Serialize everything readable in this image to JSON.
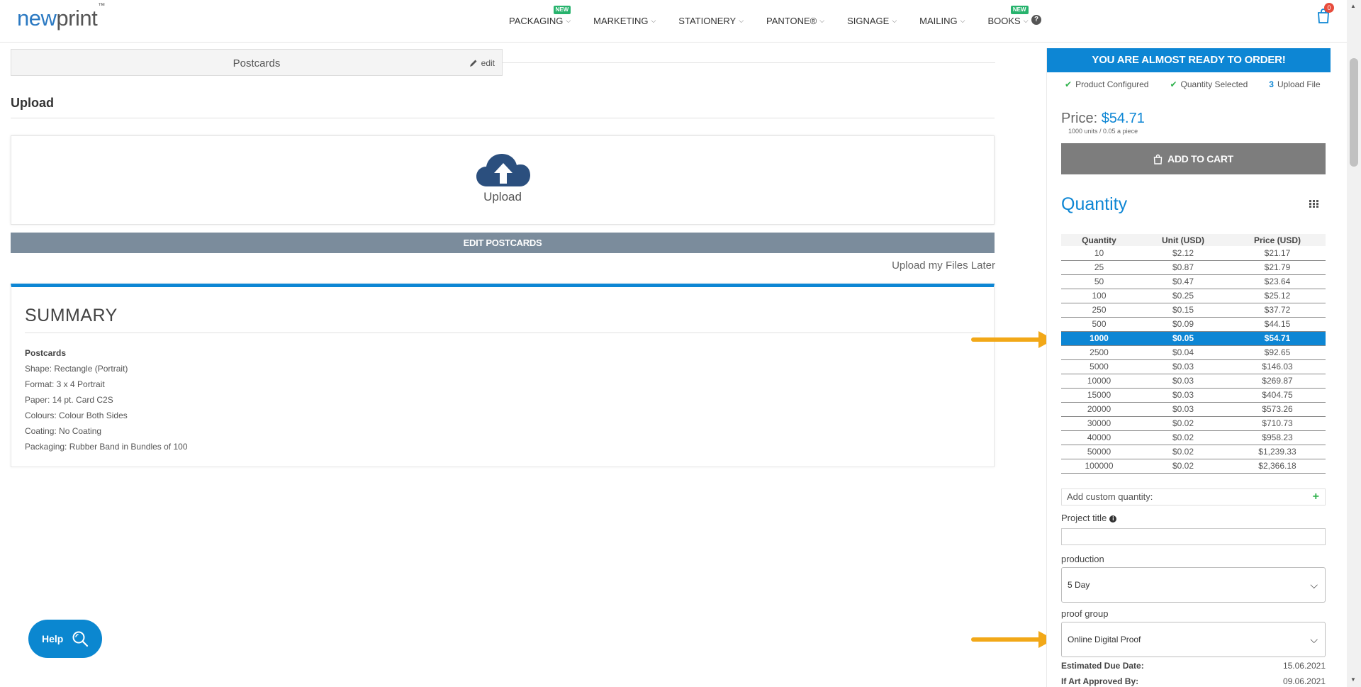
{
  "header": {
    "logo_new": "new",
    "logo_print": "print",
    "logo_tm": "™",
    "nav": [
      {
        "label": "PACKAGING",
        "badge": "NEW"
      },
      {
        "label": "MARKETING",
        "badge": ""
      },
      {
        "label": "STATIONERY",
        "badge": ""
      },
      {
        "label": "PANTONE®",
        "badge": ""
      },
      {
        "label": "SIGNAGE",
        "badge": ""
      },
      {
        "label": "MAILING",
        "badge": ""
      },
      {
        "label": "BOOKS",
        "badge": "NEW"
      }
    ],
    "help_icon": "question-circle-icon",
    "cart_icon": "shopping-bag-icon",
    "cart_count": "0"
  },
  "product_bar": {
    "name": "Postcards",
    "edit_label": "edit",
    "edit_icon": "pencil-icon"
  },
  "upload": {
    "heading": "Upload",
    "icon": "cloud-upload-icon",
    "icon_color": "#2b4f7e",
    "label": "Upload",
    "edit_button": "EDIT POSTCARDS",
    "later_link": "Upload my Files Later"
  },
  "summary": {
    "title": "SUMMARY",
    "product": "Postcards",
    "lines": [
      "Shape: Rectangle (Portrait)",
      "Format: 3 x 4 Portrait",
      "Paper: 14 pt. Card C2S",
      "Colours: Colour Both Sides",
      "Coating: No Coating",
      "Packaging: Rubber Band in Bundles of 100"
    ],
    "accent_color": "#0d86d4"
  },
  "help_widget": {
    "label": "Help",
    "icon": "search-icon"
  },
  "sidebar": {
    "ready_banner": "YOU ARE ALMOST READY TO ORDER!",
    "steps": [
      {
        "marker": "✔",
        "label": "Product Configured"
      },
      {
        "marker": "✔",
        "label": "Quantity Selected"
      },
      {
        "marker": "3",
        "label": "Upload File"
      }
    ],
    "price_label": "Price:",
    "price_value": "$54.71",
    "price_sub": "1000 units / 0.05 a piece",
    "add_to_cart": "ADD TO CART",
    "quantity_heading": "Quantity",
    "table": {
      "headers": [
        "Quantity",
        "Unit (USD)",
        "Price (USD)"
      ],
      "rows": [
        [
          "10",
          "$2.12",
          "$21.17"
        ],
        [
          "25",
          "$0.87",
          "$21.79"
        ],
        [
          "50",
          "$0.47",
          "$23.64"
        ],
        [
          "100",
          "$0.25",
          "$25.12"
        ],
        [
          "250",
          "$0.15",
          "$37.72"
        ],
        [
          "500",
          "$0.09",
          "$44.15"
        ],
        [
          "1000",
          "$0.05",
          "$54.71"
        ],
        [
          "2500",
          "$0.04",
          "$92.65"
        ],
        [
          "5000",
          "$0.03",
          "$146.03"
        ],
        [
          "10000",
          "$0.03",
          "$269.87"
        ],
        [
          "15000",
          "$0.03",
          "$404.75"
        ],
        [
          "20000",
          "$0.03",
          "$573.26"
        ],
        [
          "30000",
          "$0.02",
          "$710.73"
        ],
        [
          "40000",
          "$0.02",
          "$958.23"
        ],
        [
          "50000",
          "$0.02",
          "$1,239.33"
        ],
        [
          "100000",
          "$0.02",
          "$2,366.18"
        ]
      ],
      "selected_index": 6
    },
    "custom_quantity_label": "Add custom quantity:",
    "project_title_label": "Project title",
    "production_label": "production",
    "production_value": "5 Day",
    "proof_group_label": "proof group",
    "proof_group_value": "Online Digital Proof",
    "estimated_due_label": "Estimated Due Date:",
    "estimated_due_value": "15.06.2021",
    "art_approved_label": "If Art Approved By:",
    "art_approved_value": "09.06.2021"
  },
  "colors": {
    "brand_blue": "#0d86d4",
    "arrow_orange": "#f2a818",
    "check_green": "#2fb24c"
  }
}
